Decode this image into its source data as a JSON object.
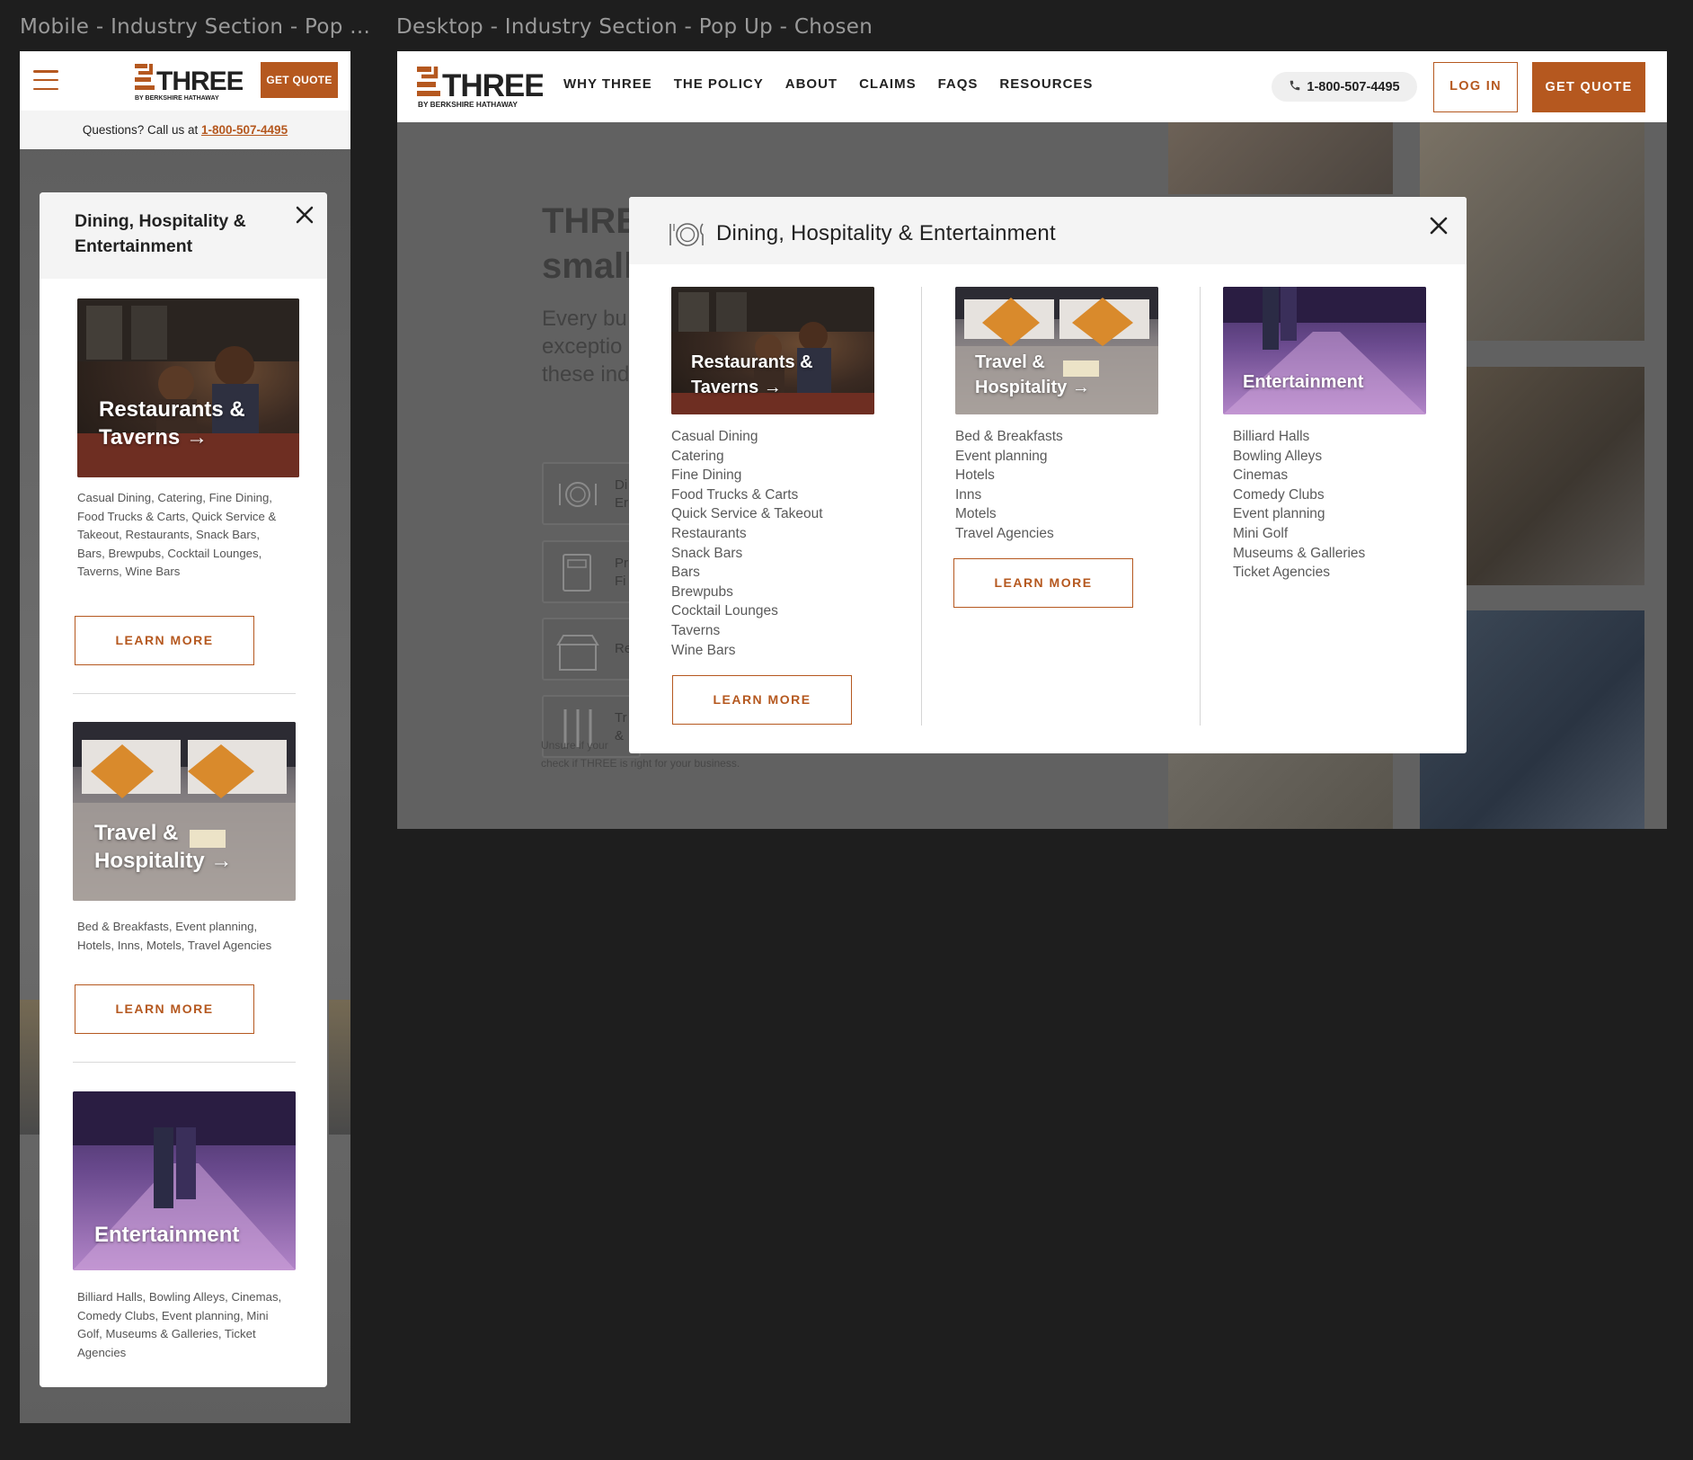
{
  "frames": {
    "mobile_label": "Mobile - Industry Section - Pop ...",
    "desktop_label": "Desktop - Industry Section - Pop Up - Chosen"
  },
  "brand": {
    "logo_text": "THREE",
    "logo_sub": "BY BERKSHIRE HATHAWAY",
    "accent": "#b5581f"
  },
  "mobile": {
    "get_quote": "GET QUOTE",
    "call_prefix": "Questions? Call us at",
    "call_number": "1-800-507-4495",
    "modal_title": "Dining, Hospitality & Entertainment",
    "sections": [
      {
        "title": "Restaurants & Taverns",
        "title_line1": "Restaurants &",
        "title_line2": "Taverns",
        "arrow": "→",
        "description": "Casual Dining, Catering, Fine Dining, Food Trucks & Carts, Quick Service & Takeout, Restaurants, Snack Bars, Bars, Brewpubs, Cocktail Lounges, Taverns, Wine Bars",
        "button": "LEARN MORE"
      },
      {
        "title": "Travel & Hospitality",
        "title_line1": "Travel &",
        "title_line2": "Hospitality",
        "arrow": "→",
        "description": "Bed & Breakfasts, Event planning, Hotels, Inns, Motels, Travel Agencies",
        "button": "LEARN MORE"
      },
      {
        "title": "Entertainment",
        "description": "Billiard Halls, Bowling Alleys, Cinemas, Comedy Clubs, Event planning, Mini Golf, Museums & Galleries, Ticket Agencies"
      }
    ]
  },
  "desktop": {
    "nav": [
      "WHY THREE",
      "THE POLICY",
      "ABOUT",
      "CLAIMS",
      "FAQS",
      "RESOURCES"
    ],
    "phone": "1-800-507-4495",
    "login": "LOG IN",
    "get_quote": "GET QUOTE",
    "hero_title_line1": "THRE",
    "hero_title_line2": "small",
    "hero_para_line1": "Every bu",
    "hero_para_line2": "exceptio",
    "hero_para_line3": "these ind",
    "tile_texts": [
      {
        "a": "Di",
        "b": "Er"
      },
      {
        "a": "Pr",
        "b": "Fi"
      },
      {
        "a": "Re",
        "b": ""
      },
      {
        "a": "Tr",
        "b": "&"
      }
    ],
    "unsure_line1": "Unsure if your",
    "unsure_line2": "check if THREE is right for your business.",
    "modal_title": "Dining, Hospitality & Entertainment",
    "columns": [
      {
        "title_line1": "Restaurants &",
        "title_line2": "Taverns",
        "arrow": "→",
        "items": [
          "Casual Dining",
          "Catering",
          "Fine Dining",
          "Food Trucks & Carts",
          "Quick Service & Takeout",
          "Restaurants",
          "Snack Bars",
          "Bars",
          "Brewpubs",
          "Cocktail Lounges",
          "Taverns",
          "Wine Bars"
        ],
        "button": "LEARN MORE"
      },
      {
        "title_line1": "Travel &",
        "title_line2": "Hospitality",
        "arrow": "→",
        "items": [
          "Bed & Breakfasts",
          "Event planning",
          "Hotels",
          "Inns",
          "Motels",
          "Travel Agencies"
        ],
        "button": "LEARN MORE"
      },
      {
        "title_line1": "Entertainment",
        "items": [
          "Billiard Halls",
          "Bowling Alleys",
          "Cinemas",
          "Comedy Clubs",
          "Event planning",
          "Mini Golf",
          "Museums & Galleries",
          "Ticket Agencies"
        ]
      }
    ]
  }
}
